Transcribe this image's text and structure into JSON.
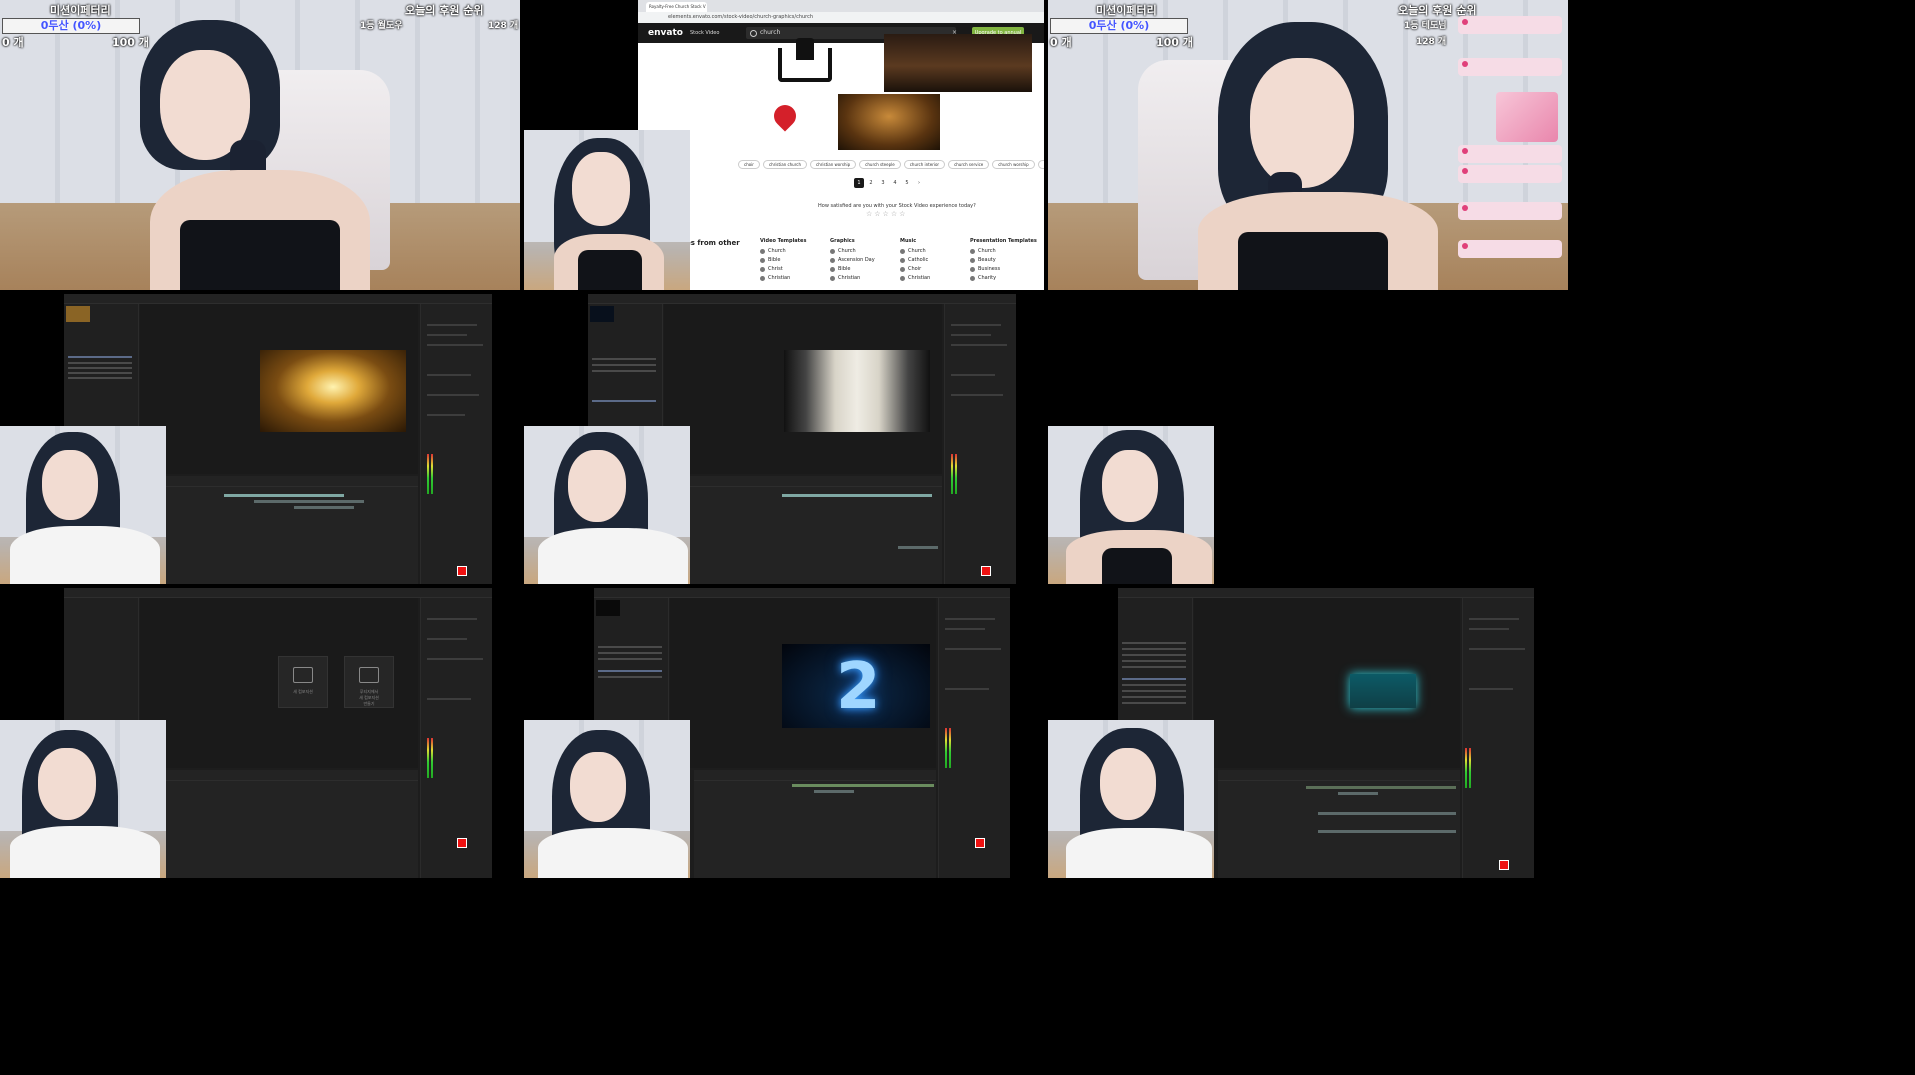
{
  "stream_overlay": {
    "left": {
      "title": "미션이페터리",
      "gauge_text": "0두산 (0%)",
      "gauge_min": "0 개",
      "gauge_max": "100 개",
      "rank_title": "오늘의 후원 순위",
      "rank_first": "1등 월도우",
      "rank_count": "128 개"
    },
    "right": {
      "title": "미션이페터리",
      "gauge_text": "0두산 (0%)",
      "gauge_min": "0 개",
      "gauge_max": "100 개",
      "rank_title": "오늘의 후원 순위",
      "rank_first": "1등 테도님",
      "rank_count": "128 개"
    }
  },
  "browser": {
    "tab_title": "Royalty-Free Church Stock V",
    "url": "elements.envato.com/stock-video/church-graphics/church",
    "logo": "envato",
    "category_menu": "Stock Video",
    "search_value": "church",
    "upgrade_button": "Upgrade to annual",
    "chips": [
      "choir",
      "christian church",
      "christian worship",
      "church steeple",
      "church interior",
      "church service",
      "church worship",
      "historic"
    ],
    "pages": [
      "1",
      "2",
      "3",
      "4",
      "5",
      "›"
    ],
    "satisfaction_question": "How satisfied are you with your Stock Video experience today?",
    "stars": "☆☆☆☆☆",
    "more_from_heading": "es from other",
    "columns": [
      {
        "heading": "Video Templates",
        "items": [
          "Church",
          "Bible",
          "Christ",
          "Christian"
        ]
      },
      {
        "heading": "Graphics",
        "items": [
          "Church",
          "Ascension Day",
          "Bible",
          "Christian"
        ]
      },
      {
        "heading": "Music",
        "items": [
          "Church",
          "Catholic",
          "Choir",
          "Christian"
        ]
      },
      {
        "heading": "Presentation Templates",
        "items": [
          "Church",
          "Beauty",
          "Business",
          "Charity"
        ]
      }
    ]
  },
  "ae_panels": {
    "empty_comp": {
      "card_left": "새 컴포지션",
      "card_right": "푸티지에서\n새 컴포지션\n만들기"
    }
  },
  "colors": {
    "envato_green": "#82b541",
    "ae_background": "#1d1d1d",
    "chat_pink": "#f6dce6"
  }
}
